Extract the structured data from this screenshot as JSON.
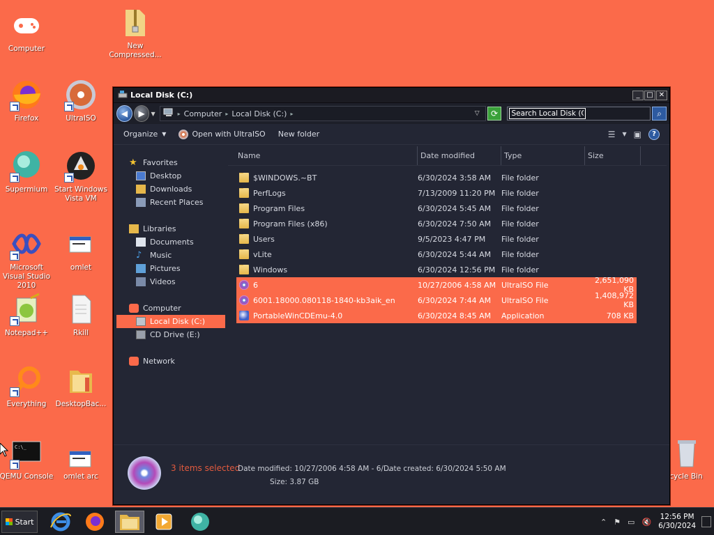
{
  "desktop": {
    "icons": [
      {
        "label": "Computer"
      },
      {
        "label": "New Compressed..."
      },
      {
        "label": "Firefox"
      },
      {
        "label": "UltraISO"
      },
      {
        "label": "Supermium"
      },
      {
        "label": "Start Windows Vista VM"
      },
      {
        "label": "Microsoft Visual Studio 2010"
      },
      {
        "label": "omlet"
      },
      {
        "label": "Notepad++"
      },
      {
        "label": "Rkill"
      },
      {
        "label": "Everything"
      },
      {
        "label": "DesktopBac..."
      },
      {
        "label": "QEMU Console"
      },
      {
        "label": "omlet arc"
      },
      {
        "label": "cycle Bin"
      }
    ]
  },
  "window": {
    "title": "Local Disk (C:)",
    "controls": {
      "minimize": "_",
      "maximize": "□",
      "close": "✕"
    },
    "address": {
      "crumbs": [
        "Computer",
        "Local Disk (C:)"
      ]
    },
    "search": {
      "value": "Search Local Disk (C:)"
    },
    "toolbar": {
      "organize": "Organize",
      "open_with": "Open with UltraISO",
      "new_folder": "New folder"
    },
    "nav": {
      "favorites": "Favorites",
      "desktop": "Desktop",
      "downloads": "Downloads",
      "recent": "Recent Places",
      "libraries": "Libraries",
      "documents": "Documents",
      "music": "Music",
      "pictures": "Pictures",
      "videos": "Videos",
      "computer": "Computer",
      "local_disk": "Local Disk (C:)",
      "cd_drive": "CD Drive (E:)",
      "network": "Network"
    },
    "columns": {
      "name": "Name",
      "date": "Date modified",
      "type": "Type",
      "size": "Size"
    },
    "files": [
      {
        "name": "$WINDOWS.~BT",
        "date": "6/30/2024 3:58 AM",
        "type": "File folder",
        "size": ""
      },
      {
        "name": "PerfLogs",
        "date": "7/13/2009 11:20 PM",
        "type": "File folder",
        "size": ""
      },
      {
        "name": "Program Files",
        "date": "6/30/2024 5:45 AM",
        "type": "File folder",
        "size": ""
      },
      {
        "name": "Program Files (x86)",
        "date": "6/30/2024 7:50 AM",
        "type": "File folder",
        "size": ""
      },
      {
        "name": "Users",
        "date": "9/5/2023 4:47 PM",
        "type": "File folder",
        "size": ""
      },
      {
        "name": "vLite",
        "date": "6/30/2024 5:44 AM",
        "type": "File folder",
        "size": ""
      },
      {
        "name": "Windows",
        "date": "6/30/2024 12:56 PM",
        "type": "File folder",
        "size": ""
      },
      {
        "name": "6",
        "date": "10/27/2006 4:58 AM",
        "type": "UltraISO File",
        "size": "2,651,090 KB"
      },
      {
        "name": "6001.18000.080118-1840-kb3aik_en",
        "date": "6/30/2024 7:44 AM",
        "type": "UltraISO File",
        "size": "1,408,972 KB"
      },
      {
        "name": "PortableWinCDEmu-4.0",
        "date": "6/30/2024 8:45 AM",
        "type": "Application",
        "size": "708 KB"
      }
    ],
    "details": {
      "selected": "3 items selected",
      "date_modified": "Date modified:  10/27/2006 4:58 AM - 6/...",
      "date_created": "Date created:  6/30/2024 5:50 AM",
      "size": "Size:  3.87 GB"
    }
  },
  "taskbar": {
    "start": "Start",
    "time": "12:56 PM",
    "date": "6/30/2024"
  },
  "colors": {
    "accent": "#fb6a4a",
    "window_bg": "#232634"
  }
}
